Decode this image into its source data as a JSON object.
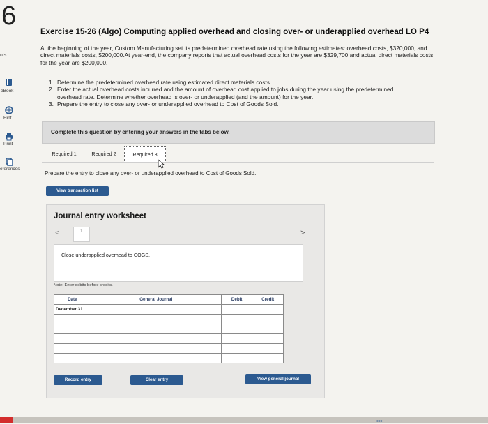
{
  "question_number": "6",
  "sidebar": {
    "cut_label_top": "nts",
    "items": [
      {
        "label": "eBook",
        "icon": "book-icon",
        "color": "#2c5a90"
      },
      {
        "label": "Hint",
        "icon": "globe-icon",
        "color": "#2c5a90"
      },
      {
        "label": "Print",
        "icon": "printer-icon",
        "color": "#2c5a90"
      },
      {
        "label": "eferences",
        "icon": "copy-icon",
        "color": "#2c5a90"
      }
    ]
  },
  "exercise": {
    "title": "Exercise 15-26 (Algo) Computing applied overhead and closing over- or underapplied overhead LO P4",
    "intro": "At the beginning of the year, Custom Manufacturing set its predetermined overhead rate using the following estimates: overhead costs, $320,000, and direct materials costs, $200,000.At year-end, the company reports that actual overhead costs for the year are $329,700 and actual direct materials costs for the year are $200,000.",
    "steps": [
      {
        "num": "1.",
        "text": "Determine the predetermined overhead rate using estimated direct materials costs"
      },
      {
        "num": "2.",
        "text": "Enter the actual overhead costs incurred and the amount of overhead cost applied to jobs during the year using the predetermined overhead rate. Determine whether overhead is over- or underapplied (and the amount) for the year."
      },
      {
        "num": "3.",
        "text": "Prepare the entry to close any over- or underapplied overhead to Cost of Goods Sold."
      }
    ]
  },
  "instruction": "Complete this question by entering your answers in the tabs below.",
  "tabs": [
    {
      "label": "Required 1"
    },
    {
      "label": "Required 2"
    },
    {
      "label": "Required 3"
    }
  ],
  "prepare_text": "Prepare the entry to close any over- or underapplied overhead to Cost of Goods Sold.",
  "view_transaction_list": "View transaction list",
  "worksheet": {
    "title": "Journal entry worksheet",
    "prev": "<",
    "page": "1",
    "next": ">",
    "description": "Close underapplied overhead to COGS.",
    "note": "Note: Enter debits before credits.",
    "headers": {
      "date": "Date",
      "journal": "General Journal",
      "debit": "Debit",
      "credit": "Credit"
    },
    "first_date": "December 31"
  },
  "buttons": {
    "record": "Record entry",
    "clear": "Clear entry",
    "view_general": "View general journal"
  },
  "colors": {
    "accent": "#2c5a90",
    "page_bg": "#f4f3ef"
  }
}
